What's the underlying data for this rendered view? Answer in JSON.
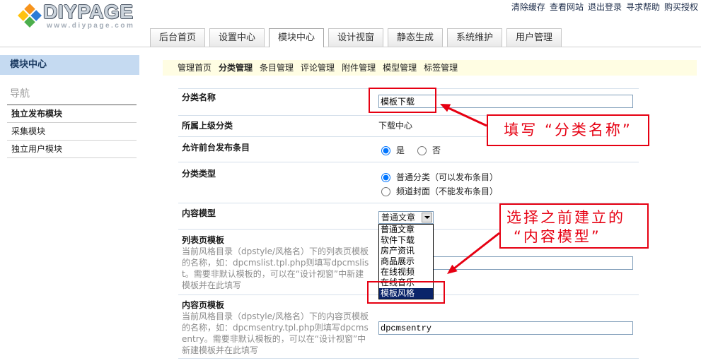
{
  "header": {
    "logo_text": "DIYPAGE",
    "logo_url_text": "www.diypage.com",
    "top_links": [
      "清除缓存",
      "查看网站",
      "退出登录",
      "寻求帮助",
      "购买授权"
    ],
    "tabs": [
      "后台首页",
      "设置中心",
      "模块中心",
      "设计视窗",
      "静态生成",
      "系统维护",
      "用户管理"
    ],
    "active_tab": "模块中心"
  },
  "sidebar": {
    "title": "模块中心",
    "nav_heading": "导航",
    "items": [
      "独立发布模块",
      "采集模块",
      "独立用户模块"
    ],
    "active_item": "独立发布模块"
  },
  "subnav": {
    "items": [
      "管理首页",
      "分类管理",
      "条目管理",
      "评论管理",
      "附件管理",
      "模型管理",
      "标签管理"
    ],
    "active_item": "分类管理"
  },
  "form": {
    "category_name": {
      "label": "分类名称",
      "value": "模板下载"
    },
    "parent_category": {
      "label": "所属上级分类",
      "value": "下载中心"
    },
    "allow_frontend_post": {
      "label": "允许前台发布条目",
      "options": [
        "是",
        "否"
      ],
      "selected": "是"
    },
    "category_type": {
      "label": "分类类型",
      "options": [
        "普通分类（可以发布条目）",
        "频道封面（不能发布条目）"
      ],
      "selected": "普通分类（可以发布条目）"
    },
    "content_model": {
      "label": "内容模型",
      "value": "普通文章",
      "options": [
        "普通文章",
        "软件下载",
        "房产资讯",
        "商品展示",
        "在线视频",
        "在线音乐",
        "模板风格"
      ],
      "highlighted_option": "模板风格",
      "dropdown_open": true
    },
    "list_template": {
      "label": "列表页模板",
      "description": "当前风格目录（dpstyle/风格名）下的列表页模板的名称，如：dpcmslist.tpl.php则填写dpcmslist。需要非默认模板的，可以在“设计视窗”中新建模板并在此填写"
    },
    "entry_template": {
      "label": "内容页模板",
      "description": "当前风格目录（dpstyle/风格名）下的内容页模板的名称，如：dpcmsentry.tpl.php则填写dpcmsentry。需要非默认模板的，可以在“设计视窗”中新建模板并在此填写",
      "value": "dpcmsentry"
    }
  },
  "annotations": {
    "callout_category_name": "填写 “分类名称”",
    "callout_content_model": [
      "选择之前建立的",
      "“内容模型”"
    ]
  },
  "colors": {
    "annotation_red": "#e60012",
    "option_highlight": "#0a246a",
    "subnav_bg": "#fffde3",
    "sidebar_title_bg": "#c5daf1"
  }
}
